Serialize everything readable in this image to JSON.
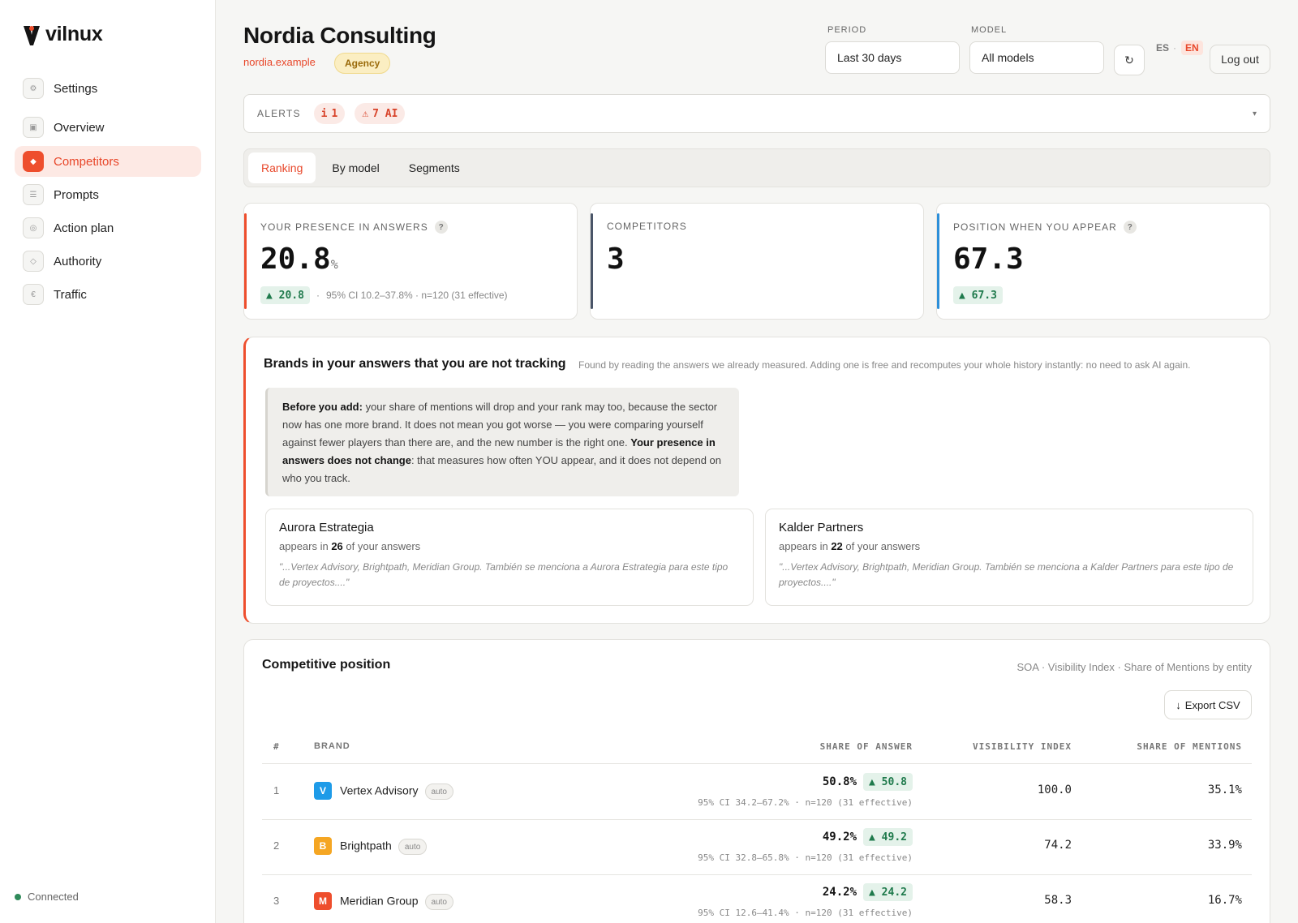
{
  "brand": {
    "name": "vilnux"
  },
  "sidebar": {
    "items": [
      {
        "label": "Settings",
        "icon": "gear-icon",
        "active": false
      },
      {
        "label": "Overview",
        "icon": "grid-icon",
        "active": false
      },
      {
        "label": "Competitors",
        "icon": "diamond-icon",
        "active": true
      },
      {
        "label": "Prompts",
        "icon": "list-icon",
        "active": false
      },
      {
        "label": "Action plan",
        "icon": "target-icon",
        "active": false
      },
      {
        "label": "Authority",
        "icon": "shield-icon",
        "active": false
      },
      {
        "label": "Traffic",
        "icon": "euro-icon",
        "active": false
      }
    ],
    "status": "Connected"
  },
  "header": {
    "title": "Nordia Consulting",
    "domain": "nordia.example",
    "badge": "Agency",
    "period_label": "PERIOD",
    "period_value": "Last 30 days",
    "model_label": "MODEL",
    "model_value": "All models",
    "refresh_icon": "refresh-icon",
    "lang_es": "ES",
    "lang_sep": "·",
    "lang_en": "EN",
    "logout": "Log out"
  },
  "alerts": {
    "label": "ALERTS",
    "info_icon": "i",
    "info_count": "1",
    "warn_icon": "⚠",
    "warn_count": "7 AI",
    "caret": "▾"
  },
  "tabs": [
    "Ranking",
    "By model",
    "Segments"
  ],
  "kpis": {
    "presence": {
      "label": "YOUR PRESENCE IN ANSWERS",
      "help": "?",
      "value": "20.8",
      "unit": "%",
      "delta": "▲ 20.8",
      "sep": "·",
      "ci": "95% CI 10.2–37.8% · n=120 (31 effective)"
    },
    "competitors": {
      "label": "COMPETITORS",
      "value": "3"
    },
    "position": {
      "label": "POSITION WHEN YOU APPEAR",
      "help": "?",
      "value": "67.3",
      "delta": "▲ 67.3"
    },
    "colors": {
      "presence": "#ee4e2d",
      "competitors": "#4a5568",
      "position": "#2d8fd9"
    }
  },
  "untracked": {
    "title": "Brands in your answers that you are not tracking",
    "subtitle": "Found by reading the answers we already measured. Adding one is free and recomputes your whole history instantly: no need to ask AI again.",
    "note_bold1": "Before you add:",
    "note_text1": " your share of mentions will drop and your rank may too, because the sector now has one more brand. It does not mean you got worse — you were comparing yourself against fewer players than there are, and the new number is the right one. ",
    "note_bold2": "Your presence in answers does not change",
    "note_text2": ": that measures how often YOU appear, and it does not depend on who you track.",
    "brands": [
      {
        "name": "Aurora Estrategia",
        "count_pre": "appears in ",
        "count": "26",
        "count_post": " of your answers",
        "quote": "\"...Vertex Advisory, Brightpath, Meridian Group. También se menciona a Aurora Estrategia para este tipo de proyectos....\""
      },
      {
        "name": "Kalder Partners",
        "count_pre": "appears in ",
        "count": "22",
        "count_post": " of your answers",
        "quote": "\"...Vertex Advisory, Brightpath, Meridian Group. También se menciona a Kalder Partners para este tipo de proyectos....\""
      }
    ]
  },
  "competitive": {
    "title": "Competitive position",
    "subtitle": "SOA · Visibility Index · Share of Mentions by entity",
    "export": "Export CSV",
    "export_icon": "↓",
    "columns": [
      "#",
      "BRAND",
      "SHARE OF ANSWER",
      "VISIBILITY INDEX",
      "SHARE OF MENTIONS"
    ],
    "rows": [
      {
        "rank": "1",
        "logo": "V",
        "logo_color": "#1e9be8",
        "brand": "Vertex Advisory",
        "tag": "auto",
        "soa": "50.8%",
        "delta": "▲ 50.8",
        "ci": "95% CI 34.2–67.2% · n=120 (31 effective)",
        "vis": "100.0",
        "som": "35.1%"
      },
      {
        "rank": "2",
        "logo": "B",
        "logo_color": "#f5a623",
        "brand": "Brightpath",
        "tag": "auto",
        "soa": "49.2%",
        "delta": "▲ 49.2",
        "ci": "95% CI 32.8–65.8% · n=120 (31 effective)",
        "vis": "74.2",
        "som": "33.9%"
      },
      {
        "rank": "3",
        "logo": "M",
        "logo_color": "#ee4e2d",
        "brand": "Meridian Group",
        "tag": "auto",
        "soa": "24.2%",
        "delta": "▲ 24.2",
        "ci": "95% CI 12.6–41.4% · n=120 (31 effective)",
        "vis": "58.3",
        "som": "16.7%"
      }
    ]
  }
}
